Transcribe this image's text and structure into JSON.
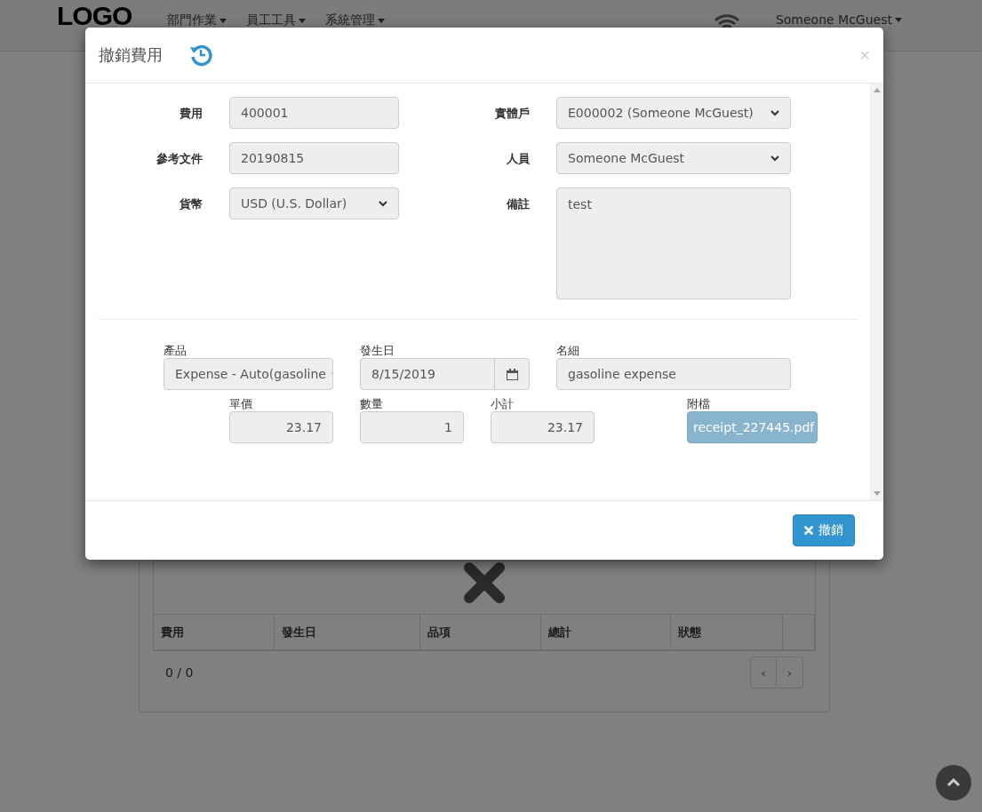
{
  "navbar": {
    "logo": "LOGO",
    "menus": [
      {
        "label": "部門作業"
      },
      {
        "label": "員工工具"
      },
      {
        "label": "系統管理"
      }
    ],
    "user": "Someone McGuest"
  },
  "page": {
    "table": {
      "columns": [
        "費用",
        "發生日",
        "品項",
        "總計",
        "狀態"
      ]
    },
    "pager": {
      "count": "0 / 0",
      "prev": "‹",
      "next": "›"
    }
  },
  "modal": {
    "title": "撤銷費用",
    "close": "×",
    "left_fields": [
      {
        "label": "費用",
        "value": "400001",
        "kind": "input"
      },
      {
        "label": "參考文件",
        "value": "20190815",
        "kind": "input"
      },
      {
        "label": "貨幣",
        "value": "USD (U.S. Dollar)",
        "kind": "select"
      }
    ],
    "right_fields": [
      {
        "label": "實體戶",
        "value": "E000002 (Someone McGuest)",
        "kind": "select"
      },
      {
        "label": "人員",
        "value": "Someone McGuest",
        "kind": "select"
      },
      {
        "label": "備註",
        "value": "test",
        "kind": "textarea"
      }
    ],
    "line": {
      "product": {
        "label": "產品",
        "value": "Expense - Auto(gasoline"
      },
      "date": {
        "label": "發生日",
        "value": "8/15/2019"
      },
      "detail": {
        "label": "名細",
        "value": "gasoline expense"
      },
      "unit_price": {
        "label": "單價",
        "value": "23.17"
      },
      "quantity": {
        "label": "數量",
        "value": "1"
      },
      "subtotal": {
        "label": "小計",
        "value": "23.17"
      },
      "attachment": {
        "label": "附檔",
        "file": "receipt_227445.pdf"
      }
    },
    "button": {
      "label": "撤銷"
    }
  }
}
